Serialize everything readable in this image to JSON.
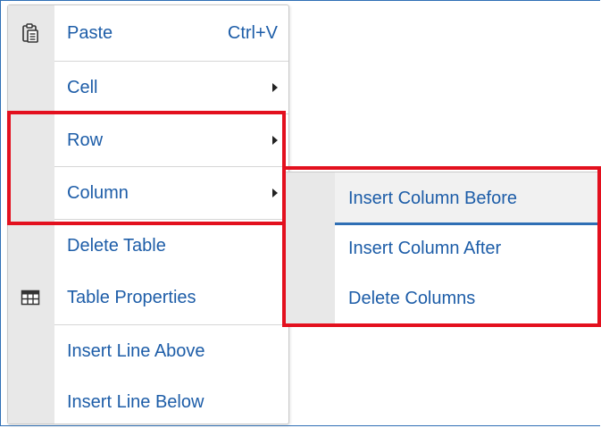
{
  "context_menu": {
    "items": [
      {
        "label": "Paste",
        "shortcut": "Ctrl+V",
        "icon": "clipboard-icon"
      },
      {
        "label": "Cell"
      },
      {
        "label": "Row"
      },
      {
        "label": "Column"
      },
      {
        "label": "Delete Table"
      },
      {
        "label": "Table Properties",
        "icon": "table-grid-icon"
      },
      {
        "label": "Insert Line Above"
      },
      {
        "label": "Insert Line Below"
      }
    ]
  },
  "column_submenu": {
    "items": [
      {
        "label": "Insert Column Before"
      },
      {
        "label": "Insert Column After"
      },
      {
        "label": "Delete Columns"
      }
    ]
  },
  "colors": {
    "accent": "#1d5da8",
    "highlight_border": "#e3101e",
    "gutter": "#e8e8e8"
  }
}
